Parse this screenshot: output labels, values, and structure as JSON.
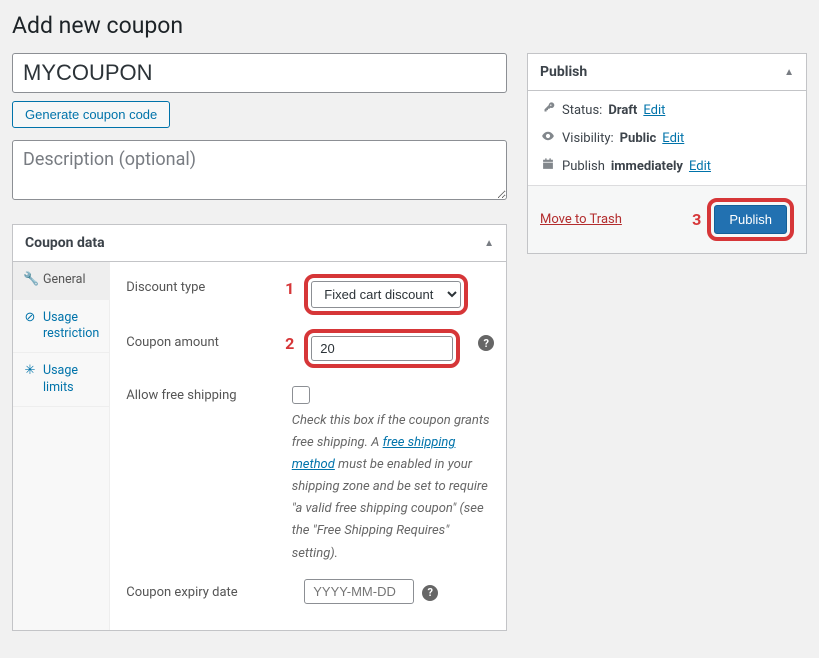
{
  "page_title": "Add new coupon",
  "coupon_code": "MYCOUPON",
  "generate_code_label": "Generate coupon code",
  "description_placeholder": "Description (optional)",
  "coupon_data": {
    "panel_title": "Coupon data",
    "tabs": {
      "general": {
        "label": "General",
        "icon": "🔧"
      },
      "usage_restriction": {
        "label": "Usage restriction",
        "icon": "⊘"
      },
      "usage_limits": {
        "label": "Usage limits",
        "icon": "✳"
      }
    },
    "fields": {
      "discount_type": {
        "label": "Discount type",
        "value": "Fixed cart discount",
        "marker": "1"
      },
      "coupon_amount": {
        "label": "Coupon amount",
        "value": "20",
        "marker": "2"
      },
      "free_shipping": {
        "label": "Allow free shipping",
        "hint_before": "Check this box if the coupon grants free shipping. A ",
        "hint_link": "free shipping method",
        "hint_after": " must be enabled in your shipping zone and be set to require \"a valid free shipping coupon\" (see the \"Free Shipping Requires\" setting)."
      },
      "expiry": {
        "label": "Coupon expiry date",
        "placeholder": "YYYY-MM-DD"
      }
    }
  },
  "publish": {
    "panel_title": "Publish",
    "status_label": "Status:",
    "status_value": "Draft",
    "visibility_label": "Visibility:",
    "visibility_value": "Public",
    "schedule_label": "Publish",
    "schedule_value": "immediately",
    "edit_label": "Edit",
    "trash_label": "Move to Trash",
    "publish_button": "Publish",
    "marker": "3"
  }
}
